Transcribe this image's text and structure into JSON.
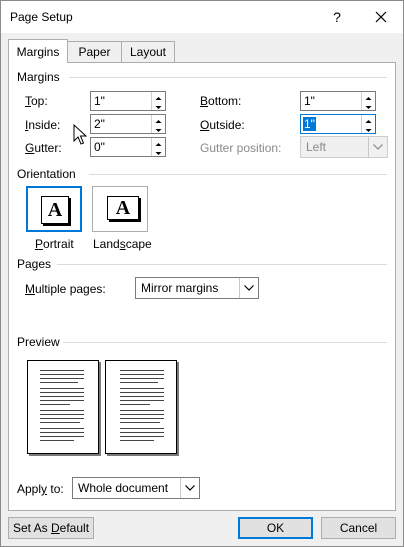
{
  "window": {
    "title": "Page Setup",
    "help_label": "?",
    "close_icon": "close-icon"
  },
  "tabs": [
    {
      "label": "Margins",
      "active": true
    },
    {
      "label": "Paper",
      "active": false
    },
    {
      "label": "Layout",
      "active": false
    }
  ],
  "margins": {
    "section_label": "Margins",
    "top": {
      "label_first": "T",
      "label_rest": "op:",
      "value": "1\""
    },
    "bottom": {
      "label_first": "B",
      "label_rest": "ottom:",
      "value": "1\""
    },
    "inside": {
      "label_first": "I",
      "label_rest": "nside:",
      "value": "2\""
    },
    "outside": {
      "label_first": "O",
      "label_rest": "utside:",
      "value": "1\"",
      "selected": true
    },
    "gutter": {
      "label_first": "G",
      "label_rest": "utter:",
      "value": "0\""
    },
    "gutter_position": {
      "label": "Gutter position:",
      "value": "Left",
      "disabled": true
    }
  },
  "orientation": {
    "section_label": "Orientation",
    "portrait": {
      "label_first": "P",
      "label_rest": "ortrait",
      "glyph": "A",
      "selected": true
    },
    "landscape": {
      "label_pre": "Land",
      "label_ul": "s",
      "label_post": "cape",
      "glyph": "A",
      "selected": false
    }
  },
  "pages": {
    "section_label": "Pages",
    "multiple_pages": {
      "label_first": "M",
      "label_rest": "ultiple pages:",
      "value": "Mirror margins"
    }
  },
  "preview": {
    "section_label": "Preview"
  },
  "apply_to": {
    "label_pre": "Appl",
    "label_ul": "y",
    "label_post": " to:",
    "value": "Whole document"
  },
  "buttons": {
    "set_default_pre": "Set As ",
    "set_default_ul": "D",
    "set_default_post": "efault",
    "ok": "OK",
    "cancel": "Cancel"
  },
  "colors": {
    "accent": "#0078d7",
    "dialog_bg": "#f0f0f0",
    "panel_bg": "#ffffff"
  }
}
